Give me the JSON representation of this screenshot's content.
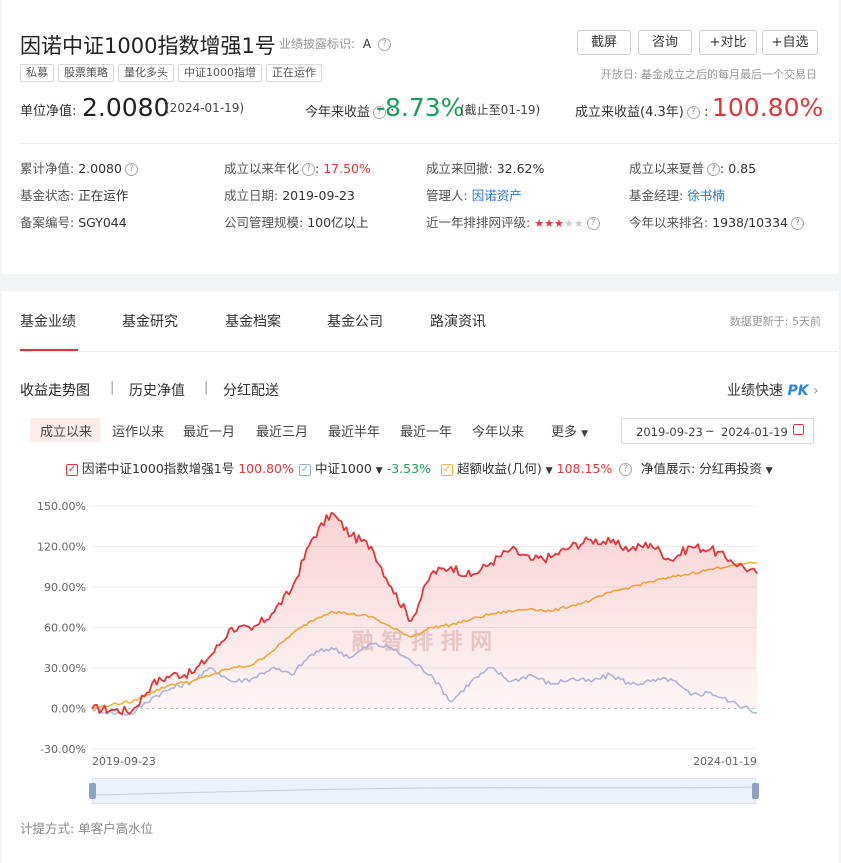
{
  "fund": {
    "name": "因诺中证1000指数增强1号",
    "disclosure_label": "业绩披露标识:",
    "disclosure_value": "A",
    "tags": [
      "私募",
      "股票策略",
      "量化多头",
      "中证1000指增",
      "正在运作"
    ],
    "open_day": "开放日: 基金成立之后的每月最后一个交易日"
  },
  "actions": {
    "screenshot": "截屏",
    "consult": "咨询",
    "compare": "+对比",
    "watchlist": "+自选"
  },
  "nav": {
    "label": "单位净值:",
    "value": "2.0080",
    "date": "(2024-01-19)",
    "ytd_label": "今年来收益",
    "ytd_value": "-8.73%",
    "ytd_note": "(截止至01-19)",
    "since_label": "成立来收益(4.3年)",
    "since_value": "100.80%"
  },
  "stats": [
    {
      "label": "累计净值:",
      "value": "2.0080"
    },
    {
      "label": "成立以来年化",
      "value": "17.50%"
    },
    {
      "label": "成立来回撤:",
      "value": "32.62%"
    },
    {
      "label": "成立以来夏普",
      "value": "0.85"
    },
    {
      "label": "基金状态:",
      "value": "正在运作"
    },
    {
      "label": "成立日期:",
      "value": "2019-09-23"
    },
    {
      "label": "管理人:",
      "value": "因诺资产"
    },
    {
      "label": "基金经理:",
      "value": "徐书楠"
    },
    {
      "label": "备案编号:",
      "value": "SGY044"
    },
    {
      "label": "公司管理规模:",
      "value": "100亿以上"
    },
    {
      "label": "近一年排排网评级:",
      "value": ""
    },
    {
      "label": "今年以来排名:",
      "value": "1938/10334"
    }
  ],
  "rating": {
    "stars": 3,
    "max": 5
  },
  "tabs": {
    "items": [
      "基金业绩",
      "基金研究",
      "基金档案",
      "基金公司",
      "路演资讯"
    ],
    "update": "数据更新于: 5天前"
  },
  "subtabs": {
    "items": [
      "收益走势图",
      "历史净值",
      "分红配送"
    ],
    "quick": "业绩快速",
    "pk": "PK"
  },
  "ranges": {
    "items": [
      "成立以来",
      "运作以来",
      "最近一月",
      "最近三月",
      "最近半年",
      "最近一年",
      "今年以来"
    ],
    "more": "更多",
    "date_from": "2019-09-23",
    "date_sep": "~",
    "date_to": "2024-01-19"
  },
  "legend": {
    "fund_name": "因诺中证1000指数增强1号",
    "fund_value": "100.80%",
    "index_name": "中证1000",
    "index_value": "-3.53%",
    "excess_name": "超额收益(几何)",
    "excess_value": "108.15%",
    "display_label": "净值展示:",
    "display_value": "分红再投资"
  },
  "watermark": "融 智 排 排 网",
  "footer": "计提方式: 单客户高水位",
  "colors": {
    "fund": "#e0373b",
    "index": "#a9bfe6",
    "excess": "#f2b43a"
  },
  "chart_data": {
    "type": "line",
    "title": "",
    "xlabel": "",
    "ylabel": "",
    "ylim": [
      -30,
      150
    ],
    "yticks": [
      "150.00%",
      "120.00%",
      "90.00%",
      "60.00%",
      "30.00%",
      "0.00%",
      "-30.00%"
    ],
    "yvalues": [
      150,
      120,
      90,
      60,
      30,
      0,
      -30
    ],
    "x_start": "2019-09-23",
    "x_end": "2024-01-19",
    "x": [
      0,
      0.03,
      0.06,
      0.09,
      0.12,
      0.15,
      0.18,
      0.21,
      0.24,
      0.27,
      0.3,
      0.33,
      0.36,
      0.39,
      0.42,
      0.45,
      0.48,
      0.51,
      0.54,
      0.57,
      0.6,
      0.63,
      0.66,
      0.69,
      0.72,
      0.75,
      0.78,
      0.81,
      0.84,
      0.87,
      0.9,
      0.93,
      0.96,
      1.0
    ],
    "series": [
      {
        "name": "因诺中证1000指数增强1号",
        "color": "#e0373b",
        "fill": true,
        "values": [
          0,
          -1,
          -2,
          18,
          25,
          26,
          40,
          60,
          58,
          70,
          88,
          125,
          145,
          128,
          120,
          90,
          65,
          100,
          105,
          98,
          108,
          118,
          110,
          112,
          120,
          125,
          123,
          118,
          122,
          110,
          120,
          118,
          110,
          100
        ]
      },
      {
        "name": "中证1000",
        "color": "#a9bfe6",
        "fill": false,
        "values": [
          0,
          -3,
          -4,
          8,
          15,
          20,
          30,
          20,
          22,
          30,
          25,
          40,
          45,
          38,
          48,
          45,
          35,
          25,
          5,
          20,
          30,
          20,
          25,
          18,
          22,
          20,
          25,
          18,
          20,
          22,
          10,
          12,
          5,
          -3
        ]
      },
      {
        "name": "超额收益(几何)",
        "color": "#f2b43a",
        "fill": false,
        "values": [
          0,
          3,
          5,
          12,
          18,
          20,
          25,
          30,
          32,
          42,
          55,
          65,
          72,
          70,
          68,
          60,
          53,
          60,
          62,
          66,
          70,
          72,
          74,
          72,
          76,
          80,
          86,
          90,
          94,
          97,
          100,
          103,
          106,
          108
        ]
      }
    ]
  }
}
